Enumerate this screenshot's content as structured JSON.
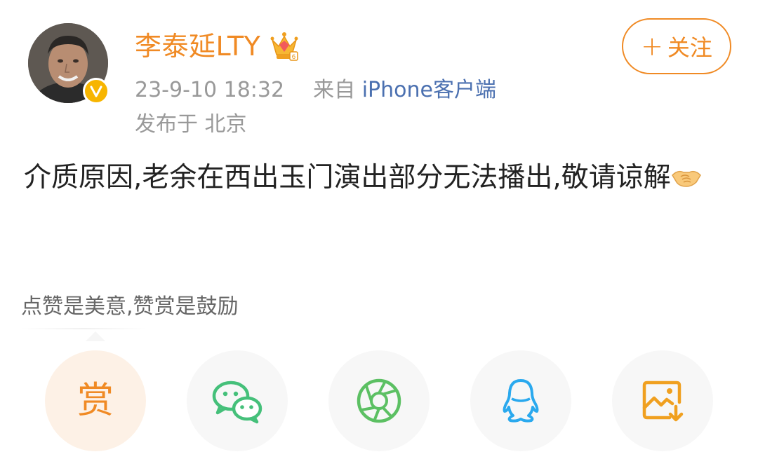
{
  "post": {
    "username": "李泰延LTY",
    "timestamp": "23-9-10 18:32",
    "source_prefix": "来自",
    "source_name": "iPhone客户端",
    "location": "发布于 北京",
    "follow_label": "关注",
    "follow_plus": "+",
    "content": "介质原因,老余在西出玉门演出部分无法播出,敬请谅解",
    "content_emoji": "handshake-icon"
  },
  "reward": {
    "tip": "点赞是美意,赞赏是鼓励",
    "reward_label": "赏"
  },
  "share_actions": [
    {
      "icon": "reward-icon",
      "name": "赏"
    },
    {
      "icon": "wechat-icon"
    },
    {
      "icon": "moments-icon"
    },
    {
      "icon": "qq-icon"
    },
    {
      "icon": "save-image-icon"
    }
  ],
  "colors": {
    "accent": "#f08a24",
    "link": "#4b70b0",
    "meta": "#999999",
    "wechat": "#45c07a",
    "moments": "#5cc063",
    "qq": "#2aa9ee",
    "save": "#f0a020"
  }
}
